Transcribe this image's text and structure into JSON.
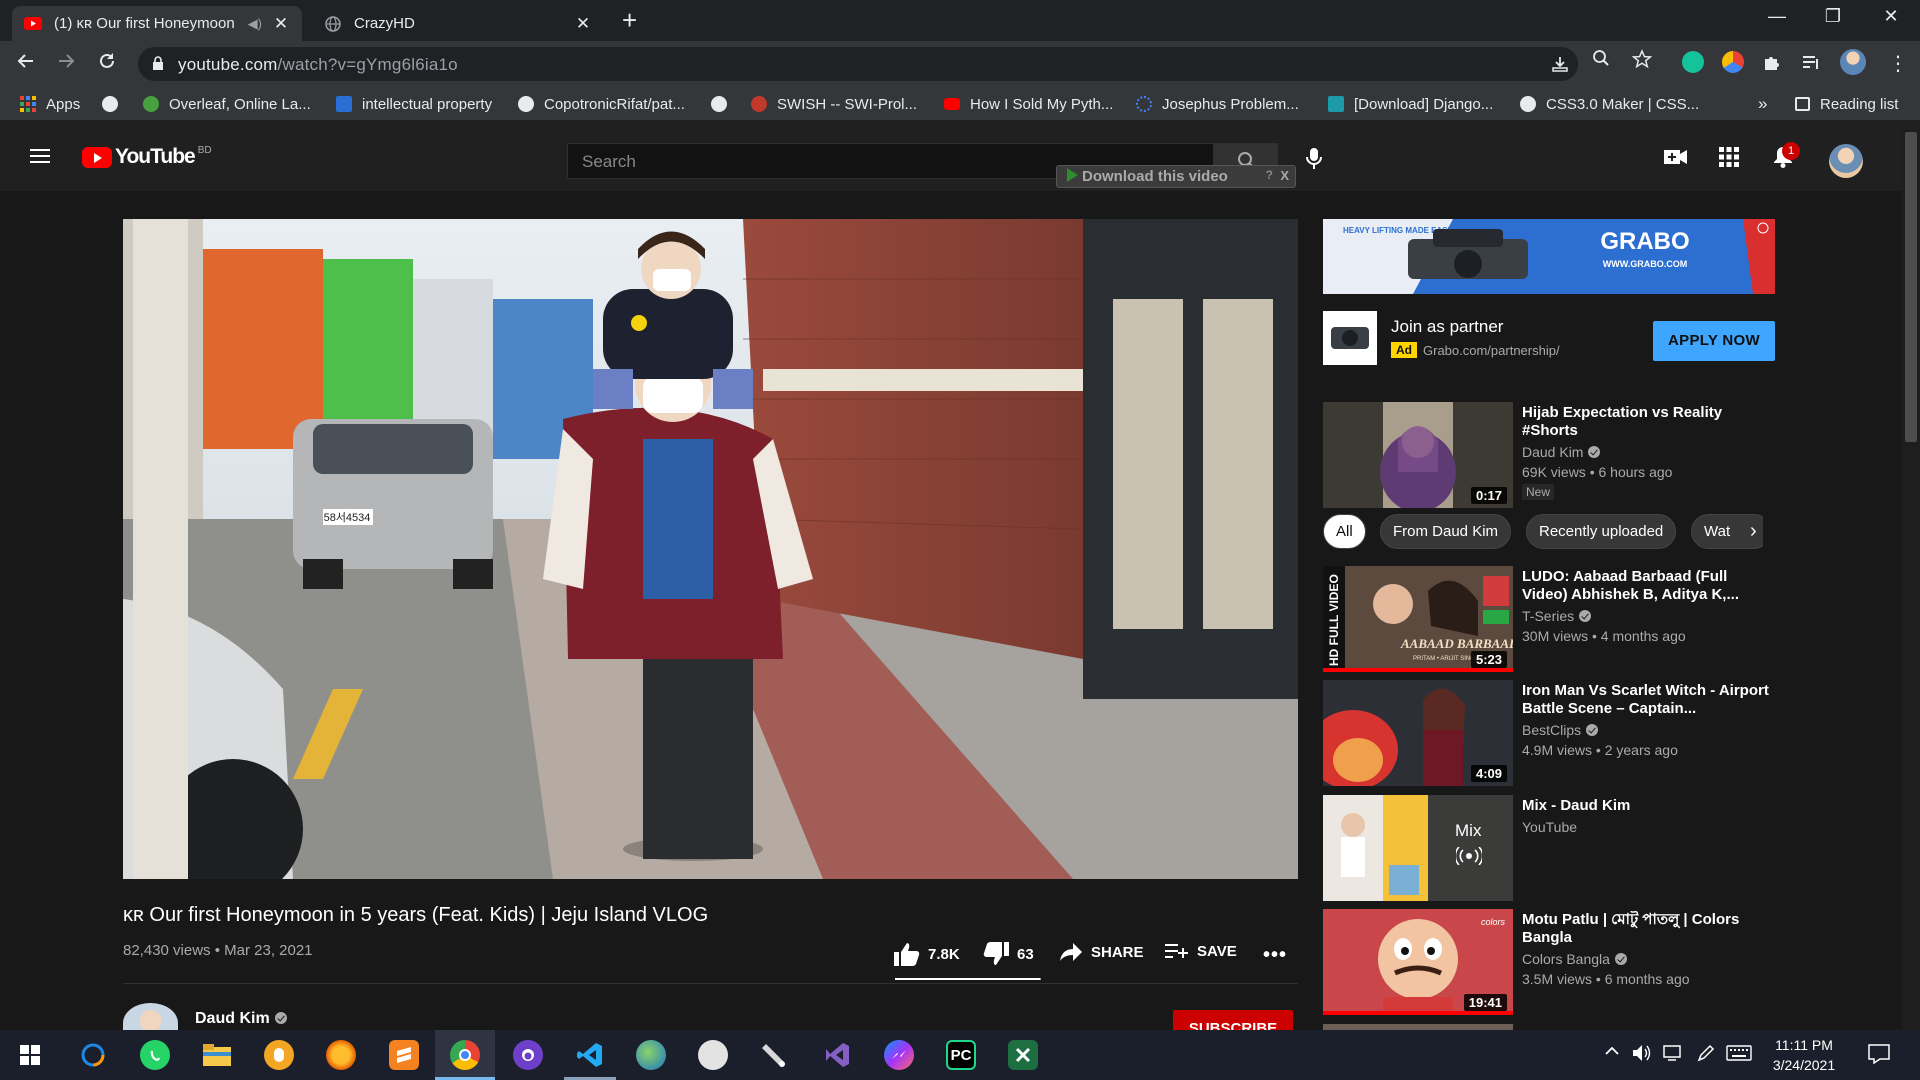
{
  "browser": {
    "tabs": [
      {
        "title": "(1) ᴋʀ Our first Honeymoon i",
        "active": true
      },
      {
        "title": "CrazyHD",
        "active": false
      }
    ],
    "url_host": "youtube.com",
    "url_path": "/watch?v=gYmg6l6ia1o",
    "bookmarks": [
      "Apps",
      "Overleaf, Online La...",
      "intellectual property",
      "CopotronicRifat/pat...",
      "SWISH -- SWI-Prol...",
      "How I Sold My Pyth...",
      "Josephus Problem...",
      "[Download] Django...",
      "CSS3.0 Maker | CSS..."
    ],
    "bookmarks_more": "»",
    "reading_list": "Reading list"
  },
  "youtube": {
    "logo_text": "YouTube",
    "country_code": "BD",
    "search_placeholder": "Search",
    "download_ext_label": "Download this video",
    "download_ext_help": "?",
    "download_ext_close": "X",
    "notification_count": "1"
  },
  "video": {
    "title": "ᴋʀ Our first Honeymoon in 5 years (Feat. Kids) | Jeju Island VLOG",
    "meta": "82,430 views • Mar 23, 2021",
    "likes": "7.8K",
    "like_ratio": 0.992,
    "dislikes": "63",
    "share_label": "SHARE",
    "save_label": "SAVE",
    "channel": "Daud Kim",
    "subscribe_label": "SUBSCRIBE",
    "plate_text": "58서4534"
  },
  "ad": {
    "banner_brand": "GRABO",
    "banner_url": "WWW.GRABO.COM",
    "banner_tagline": "HEAVY LIFTING MADE EASY",
    "title": "Join as partner",
    "badge": "Ad",
    "url": "Grabo.com/partnership/",
    "cta": "APPLY NOW"
  },
  "chips": [
    "All",
    "From Daud Kim",
    "Recently uploaded",
    "Wat"
  ],
  "recommendations": [
    {
      "title": "Hijab Expectation vs Reality #Shorts",
      "channel": "Daud Kim",
      "verified": true,
      "views": "69K views • 6 hours ago",
      "badge": "New",
      "duration": "0:17"
    },
    {
      "title": "LUDO: Aabaad Barbaad (Full Video) Abhishek B, Aditya K,...",
      "channel": "T-Series",
      "verified": true,
      "views": "30M views • 4 months ago",
      "duration": "5:23",
      "thumb_caption": "AABAAD BARBAAD",
      "thumb_side": "HD FULL VIDEO",
      "thumb_credit": "PRITAM • ARIJIT SINGH"
    },
    {
      "title": "Iron Man Vs Scarlet Witch - Airport Battle Scene – Captain...",
      "channel": "BestClips",
      "verified": true,
      "views": "4.9M views • 2 years ago",
      "duration": "4:09"
    },
    {
      "title": "Mix - Daud Kim",
      "channel": "YouTube",
      "verified": false,
      "views": "",
      "mix_label": "Mix"
    },
    {
      "title": "Motu Patlu | মোটু পাতলু | Colors Bangla",
      "channel": "Colors Bangla",
      "verified": true,
      "views": "3.5M views • 6 months ago",
      "duration": "19:41",
      "thumb_logo": "colors"
    }
  ],
  "taskbar": {
    "time": "11:11 PM",
    "date": "3/24/2021",
    "pycharm_label": "PC"
  },
  "colors": {
    "yt_red": "#ff0000",
    "apply_blue": "#3ea6ff",
    "subscribe_red": "#cc0000"
  }
}
